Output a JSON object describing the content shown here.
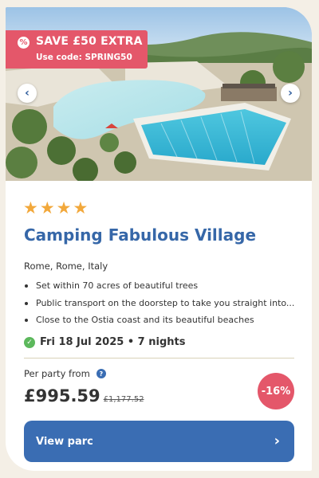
{
  "promo": {
    "icon": "percent-icon",
    "title": "SAVE £50 EXTRA",
    "code_text": "Use code: SPRING50"
  },
  "gallery": {
    "prev_icon": "chevron-left-icon",
    "next_icon": "chevron-right-icon"
  },
  "listing": {
    "star_rating": 4,
    "name": "Camping Fabulous Village",
    "location": "Rome, Rome, Italy",
    "features": [
      "Set within 70 acres of beautiful trees",
      "Public transport on the doorstep to take you straight into...",
      "Close to the Ostia coast and its beautiful beaches"
    ],
    "date_text": "Fri 18 Jul 2025 • 7 nights"
  },
  "pricing": {
    "label": "Per party from",
    "price": "£995.59",
    "old_price": "£1,177.52",
    "discount": "-16%"
  },
  "cta": {
    "label": "View parc"
  },
  "colors": {
    "accent": "#3a6db3",
    "promo": "#e4576a",
    "star": "#f2a83b",
    "success": "#5cb85c",
    "background": "#f4efe6"
  }
}
